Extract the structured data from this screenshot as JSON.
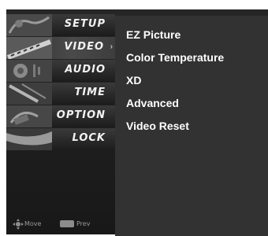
{
  "main_menu": {
    "items": [
      {
        "label": "SETUP",
        "selected": false,
        "icon": "setup-thumbnail"
      },
      {
        "label": "VIDEO",
        "selected": true,
        "icon": "video-thumbnail",
        "arrow": "›"
      },
      {
        "label": "AUDIO",
        "selected": false,
        "icon": "audio-thumbnail"
      },
      {
        "label": "TIME",
        "selected": false,
        "icon": "time-thumbnail"
      },
      {
        "label": "OPTION",
        "selected": false,
        "icon": "option-thumbnail"
      },
      {
        "label": "LOCK",
        "selected": false,
        "icon": "lock-thumbnail"
      }
    ]
  },
  "footer": {
    "move_label": "Move",
    "prev_label": "Prev",
    "move_icon": "dpad-icon",
    "menu_key_icon": "menu-key-icon"
  },
  "submenu": {
    "items": [
      {
        "label": "EZ Picture"
      },
      {
        "label": "Color Temperature"
      },
      {
        "label": "XD"
      },
      {
        "label": "Advanced"
      },
      {
        "label": "Video Reset"
      }
    ]
  },
  "colors": {
    "panel": "#323232",
    "menu": "#1c1c1c",
    "text": "#ffffff"
  }
}
